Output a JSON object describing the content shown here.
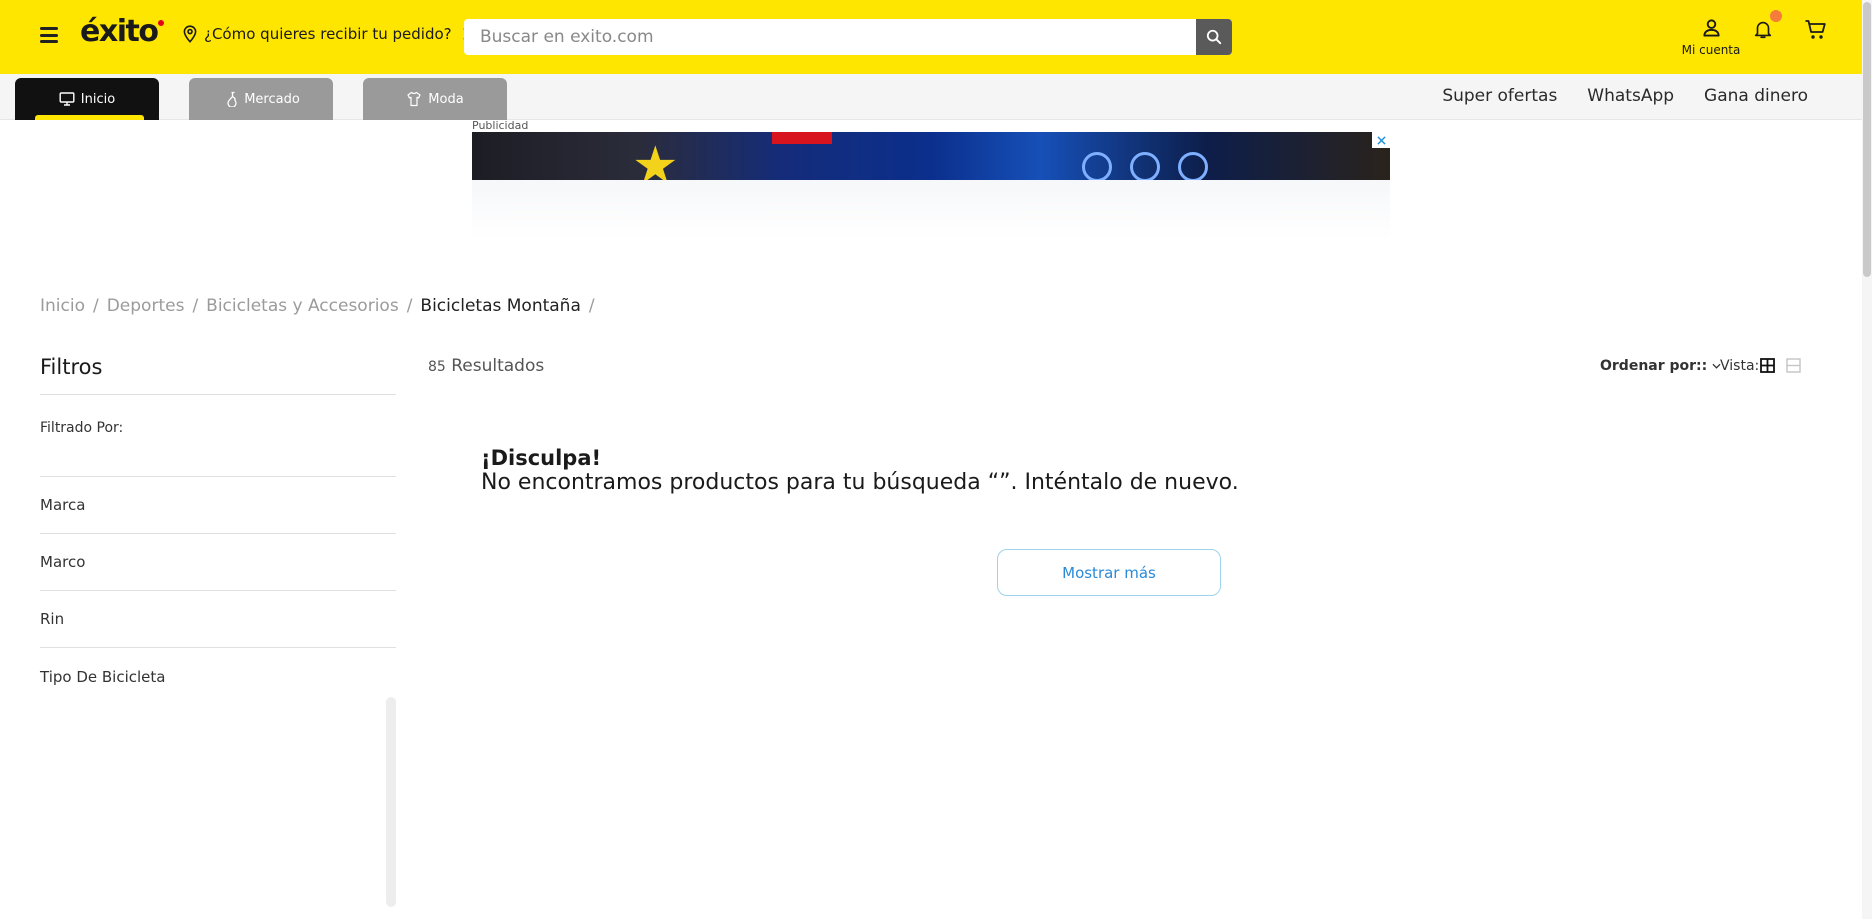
{
  "header": {
    "logo": "éxito",
    "location_prompt": "¿Cómo quieres recibir tu pedido?",
    "search_placeholder": "Buscar en exito.com",
    "account_label": "Mi cuenta",
    "brand_color": "#ffe600"
  },
  "categories": {
    "tabs": [
      {
        "label": "Inicio",
        "icon": "monitor-icon",
        "active": true
      },
      {
        "label": "Mercado",
        "icon": "bottle-icon",
        "active": false
      },
      {
        "label": "Moda",
        "icon": "shirt-icon",
        "active": false
      }
    ],
    "links": [
      "Super ofertas",
      "WhatsApp",
      "Gana dinero"
    ]
  },
  "ad": {
    "label": "Publicidad"
  },
  "breadcrumb": {
    "items": [
      "Inicio",
      "Deportes",
      "Bicicletas y Accesorios"
    ],
    "current": "Bicicletas Montaña",
    "separator": "/"
  },
  "filters": {
    "title": "Filtros",
    "filtered_by": "Filtrado Por:",
    "groups": [
      "Marca",
      "Marco",
      "Rin",
      "Tipo De Bicicleta"
    ]
  },
  "results": {
    "count": "85",
    "count_label": "Resultados",
    "sort_label": "Ordenar por::",
    "view_label": "Vista:",
    "sorry_title": "¡Disculpa!",
    "sorry_message": "No encontramos productos para tu búsqueda  “”. Inténtalo de nuevo.",
    "more_button": "Mostrar más"
  }
}
